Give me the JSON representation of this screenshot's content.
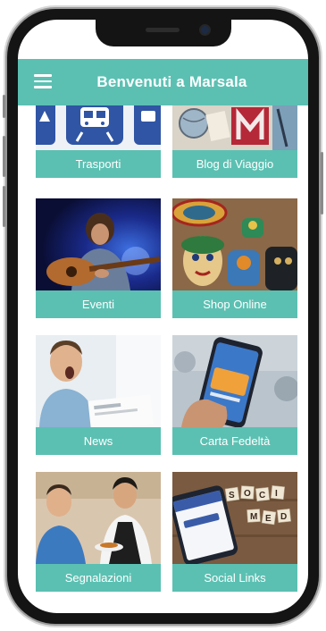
{
  "header": {
    "title": "Benvenuti a Marsala",
    "menu_icon": "hamburger-menu-icon",
    "color": "#5bc0b2"
  },
  "tiles": [
    {
      "label": "Trasporti",
      "icon": "transport-icon"
    },
    {
      "label": "Blog di Viaggio",
      "icon": "travel-blog-icon"
    },
    {
      "label": "Eventi",
      "icon": "guitar-player-photo"
    },
    {
      "label": "Shop Online",
      "icon": "souvenir-photo"
    },
    {
      "label": "News",
      "icon": "news-photo"
    },
    {
      "label": "Carta Fedeltà",
      "icon": "loyalty-card-photo"
    },
    {
      "label": "Segnalazioni",
      "icon": "reports-photo"
    },
    {
      "label": "Social Links",
      "icon": "social-media-photo"
    }
  ]
}
